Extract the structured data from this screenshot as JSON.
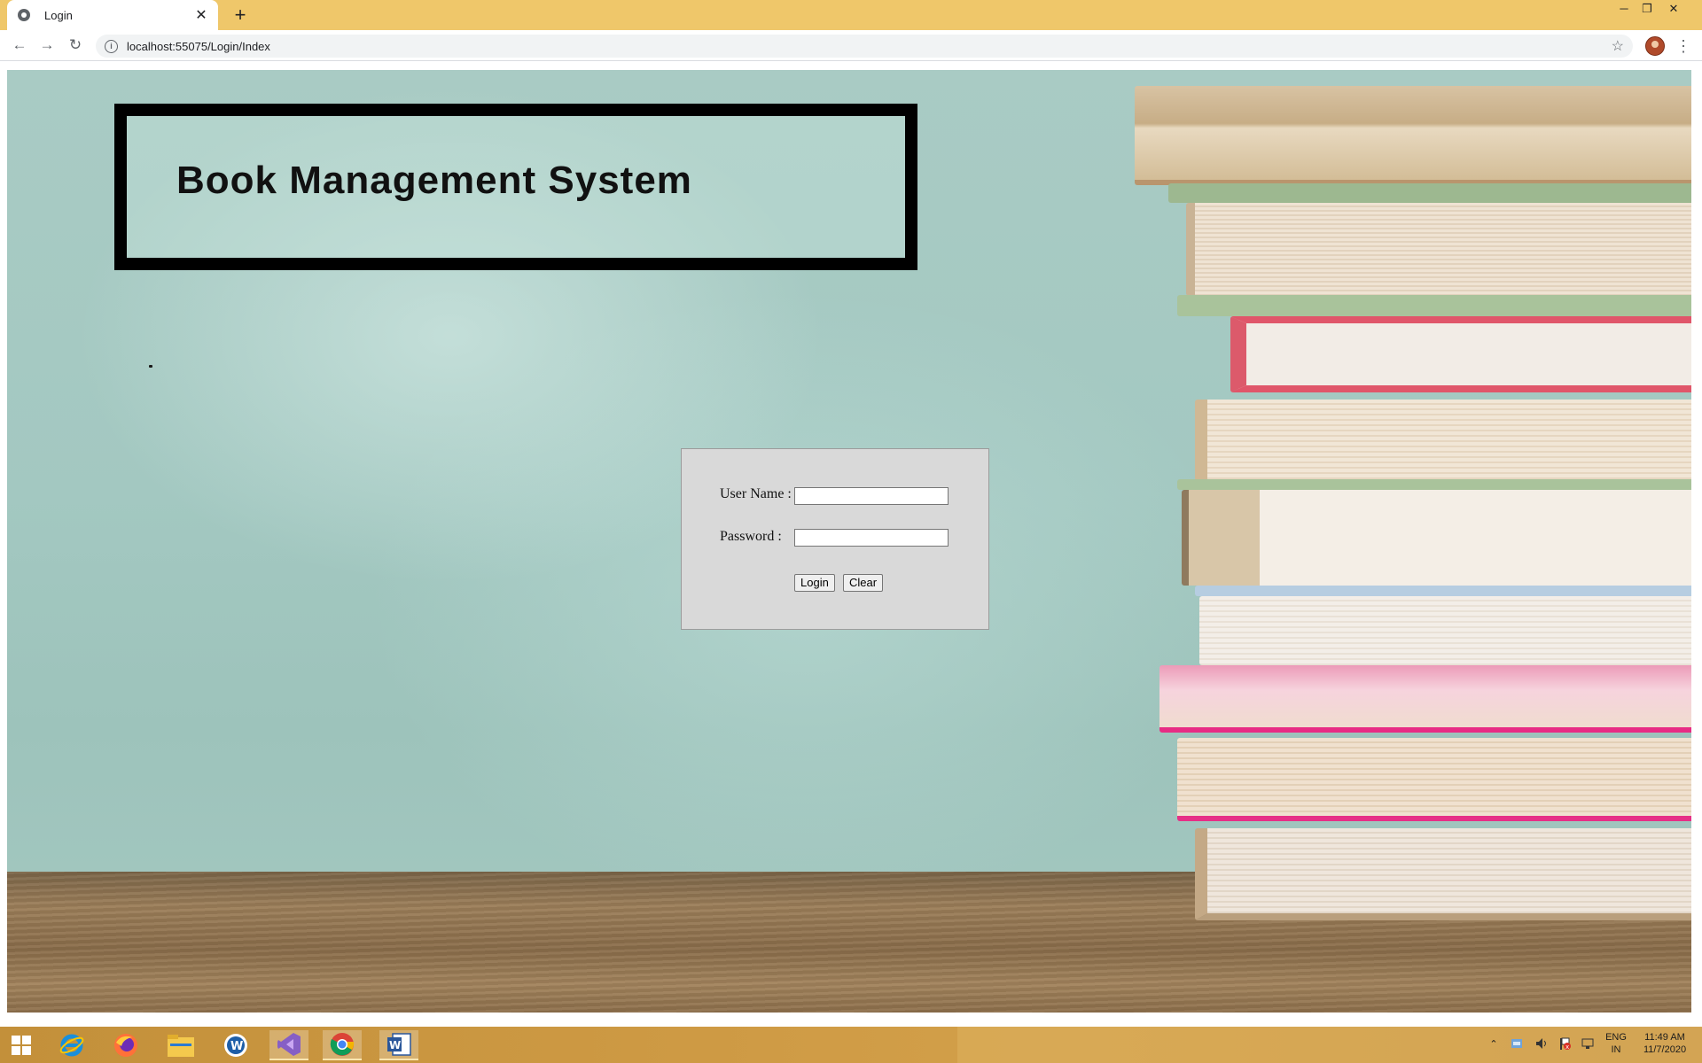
{
  "browser": {
    "tab_title": "Login",
    "new_tab": "+",
    "tab_close": "✕",
    "url": "localhost:55075/Login/Index",
    "window_controls": {
      "minimize": "─",
      "restore": "❐",
      "close": "✕"
    },
    "nav": {
      "back": "←",
      "forward": "→",
      "reload": "↻",
      "info": "i",
      "star": "☆",
      "menu": "⋮"
    }
  },
  "page": {
    "banner_title": "Book Management System",
    "login": {
      "username_label": "User Name :",
      "password_label": "Password :",
      "username_value": "",
      "password_value": "",
      "login_button": "Login",
      "clear_button": "Clear"
    }
  },
  "taskbar": {
    "apps": [
      "windows-start-icon",
      "internet-explorer-icon",
      "firefox-icon",
      "file-explorer-icon",
      "webex-icon",
      "visual-studio-icon",
      "chrome-icon",
      "word-icon"
    ],
    "tray": {
      "language": "ENG",
      "region": "IN",
      "time": "11:49 AM",
      "date": "11/7/2020",
      "overflow": "⌃"
    }
  },
  "colors": {
    "titlebar": "#efc76a",
    "taskbar": "#cf9b45",
    "wall": "#a3c8c1",
    "panel": "#d9d9d9"
  }
}
